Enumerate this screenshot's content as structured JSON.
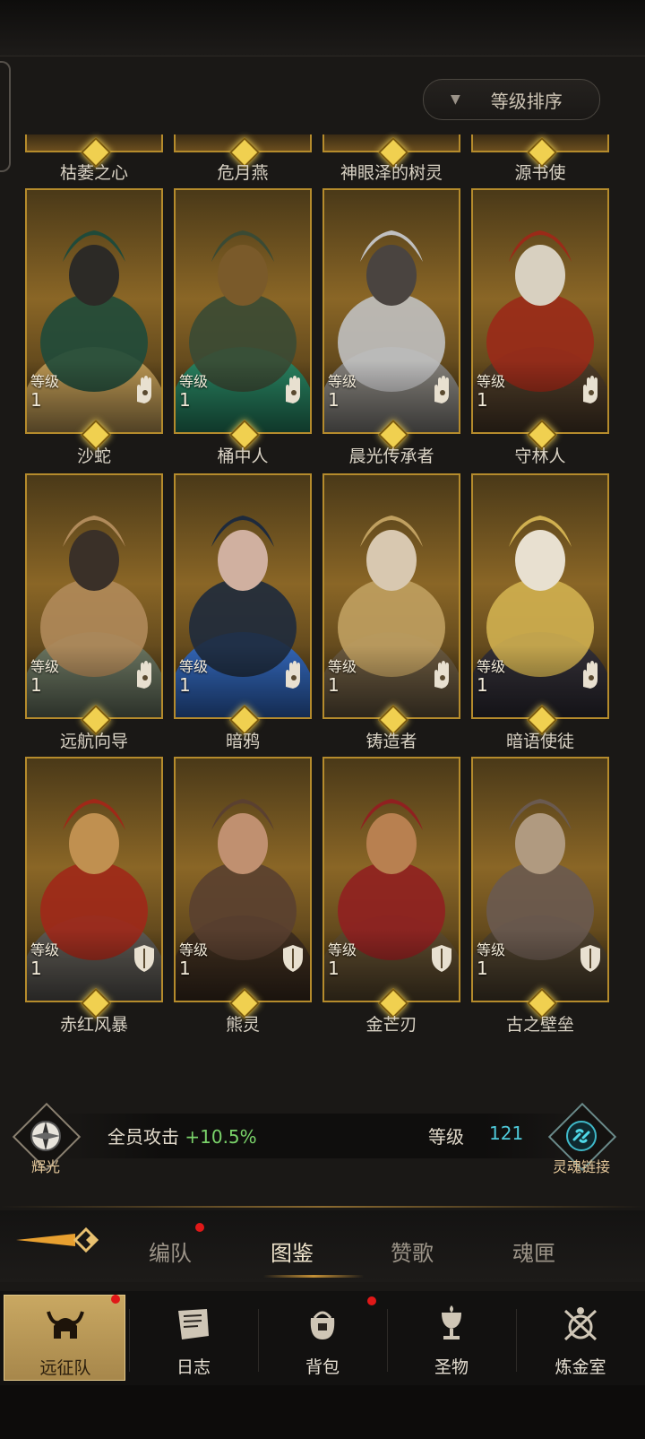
{
  "sort": {
    "label": "等级排序"
  },
  "top_row_names": [
    "枯萎之心",
    "危月燕",
    "神眼泽的树灵",
    "源书使"
  ],
  "heroes": [
    {
      "name": "沙蛇",
      "level_label": "等级",
      "level": "1",
      "type": "hand",
      "palette": [
        "#1f4a3a",
        "#c9a35c",
        "#2c2a26"
      ]
    },
    {
      "name": "桶中人",
      "level_label": "等级",
      "level": "1",
      "type": "hand",
      "palette": [
        "#3a4a34",
        "#1f8a6a",
        "#7a5a2a"
      ]
    },
    {
      "name": "晨光传承者",
      "level_label": "等级",
      "level": "1",
      "type": "hand",
      "palette": [
        "#c0c0c0",
        "#8a8a8a",
        "#4a4440"
      ]
    },
    {
      "name": "守林人",
      "level_label": "等级",
      "level": "1",
      "type": "hand",
      "palette": [
        "#9a2a18",
        "#4a3a2a",
        "#d8d0c0"
      ]
    },
    {
      "name": "远航向导",
      "level_label": "等级",
      "level": "1",
      "type": "hand",
      "palette": [
        "#b08a5a",
        "#6a7a6a",
        "#3a3028"
      ]
    },
    {
      "name": "暗鸦",
      "level_label": "等级",
      "level": "1",
      "type": "hand",
      "palette": [
        "#1e2a3c",
        "#2a6ad0",
        "#d0b0a0"
      ]
    },
    {
      "name": "铸造者",
      "level_label": "等级",
      "level": "1",
      "type": "hand",
      "palette": [
        "#c0a060",
        "#6a5a44",
        "#d8c8b0"
      ]
    },
    {
      "name": "暗语使徒",
      "level_label": "等级",
      "level": "1",
      "type": "hand",
      "palette": [
        "#d0b050",
        "#2a2a3a",
        "#e8e0d0"
      ]
    },
    {
      "name": "赤红风暴",
      "level_label": "等级",
      "level": "1",
      "type": "shield",
      "palette": [
        "#a02818",
        "#5a5a5a",
        "#c09050"
      ]
    },
    {
      "name": "熊灵",
      "level_label": "等级",
      "level": "1",
      "type": "shield",
      "palette": [
        "#5a4030",
        "#3a2a20",
        "#c09070"
      ]
    },
    {
      "name": "金芒刃",
      "level_label": "等级",
      "level": "1",
      "type": "shield",
      "palette": [
        "#902020",
        "#5a4a30",
        "#b88050"
      ]
    },
    {
      "name": "古之壁垒",
      "level_label": "等级",
      "level": "1",
      "type": "shield",
      "palette": [
        "#6a5a50",
        "#4a4030",
        "#b09a80"
      ]
    }
  ],
  "stats": {
    "left_caption": "辉光",
    "attack_label": "全员攻击",
    "attack_value": "+10.5%",
    "level_label": "等级",
    "level_value": "121",
    "right_caption": "灵魂链接"
  },
  "tabs": [
    {
      "label": "编队",
      "badge": true
    },
    {
      "label": "图鉴",
      "active": true
    },
    {
      "label": "赞歌"
    },
    {
      "label": "魂匣"
    }
  ],
  "nav": [
    {
      "label": "远征队",
      "icon": "helmet-icon",
      "active": true,
      "badge": true
    },
    {
      "label": "日志",
      "icon": "scroll-icon"
    },
    {
      "label": "背包",
      "icon": "bag-icon",
      "badge": true
    },
    {
      "label": "圣物",
      "icon": "chalice-icon"
    },
    {
      "label": "炼金室",
      "icon": "alchemy-icon"
    }
  ],
  "colors": {
    "gold": "#b58b2c",
    "gem": "#f0d050",
    "attack_green": "#7ad36a",
    "level_cyan": "#4fc9d9",
    "badge_red": "#e01818"
  }
}
